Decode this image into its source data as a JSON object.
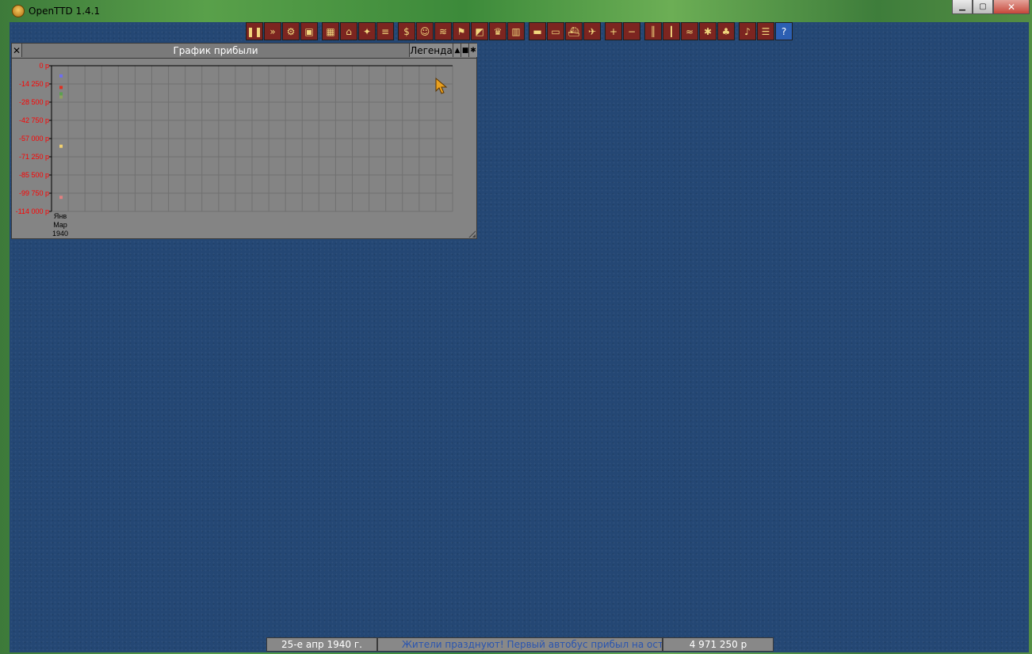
{
  "window": {
    "title": "OpenTTD 1.4.1",
    "controls": {
      "minimize": "▁",
      "maximize": "▢",
      "close": "✕"
    }
  },
  "toolbar": {
    "buttons": [
      {
        "name": "pause-button",
        "icon": "pause-icon",
        "glyph": "❚❚"
      },
      {
        "name": "fast-forward-button",
        "icon": "fast-forward-icon",
        "glyph": "»"
      },
      {
        "name": "settings-button",
        "icon": "gear-icon",
        "glyph": "⚙"
      },
      {
        "name": "save-button",
        "icon": "disk-icon",
        "glyph": "▣"
      },
      {
        "name": "map-button",
        "icon": "map-icon",
        "glyph": "▦"
      },
      {
        "name": "town-list-button",
        "icon": "town-icon",
        "glyph": "⌂"
      },
      {
        "name": "subsidies-button",
        "icon": "subsidies-icon",
        "glyph": "✦"
      },
      {
        "name": "station-list-button",
        "icon": "station-icon",
        "glyph": "≡"
      },
      {
        "name": "finances-button",
        "icon": "coins-icon",
        "glyph": "$"
      },
      {
        "name": "company-button",
        "icon": "face-icon",
        "glyph": "☺"
      },
      {
        "name": "story-button",
        "icon": "book-icon",
        "glyph": "≋"
      },
      {
        "name": "goals-button",
        "icon": "flag-icon",
        "glyph": "⚑"
      },
      {
        "name": "graphs-button",
        "icon": "graph-icon",
        "glyph": "◩"
      },
      {
        "name": "league-button",
        "icon": "trophy-icon",
        "glyph": "♛"
      },
      {
        "name": "industries-button",
        "icon": "factory-icon",
        "glyph": "▥"
      },
      {
        "name": "trains-button",
        "icon": "train-icon",
        "glyph": "▬"
      },
      {
        "name": "road-vehicles-button",
        "icon": "bus-icon",
        "glyph": "▭"
      },
      {
        "name": "ships-button",
        "icon": "ship-icon",
        "glyph": "⛴"
      },
      {
        "name": "aircraft-button",
        "icon": "plane-icon",
        "glyph": "✈"
      },
      {
        "name": "zoom-in-button",
        "icon": "zoom-in-icon",
        "glyph": "+"
      },
      {
        "name": "zoom-out-button",
        "icon": "zoom-out-icon",
        "glyph": "−"
      },
      {
        "name": "build-rail-button",
        "icon": "rail-icon",
        "glyph": "║"
      },
      {
        "name": "build-road-button",
        "icon": "road-icon",
        "glyph": "┃"
      },
      {
        "name": "build-water-button",
        "icon": "water-icon",
        "glyph": "≈"
      },
      {
        "name": "build-air-button",
        "icon": "airport-icon",
        "glyph": "✱"
      },
      {
        "name": "landscaping-button",
        "icon": "tree-icon",
        "glyph": "♣"
      },
      {
        "name": "sound-button",
        "icon": "speaker-icon",
        "glyph": "♪"
      },
      {
        "name": "messages-button",
        "icon": "list-icon",
        "glyph": "☰"
      },
      {
        "name": "help-button",
        "icon": "help-icon",
        "glyph": "?"
      }
    ]
  },
  "graph_window": {
    "title": "График прибыли",
    "legend_label": "Легенда",
    "close_glyph": "✕",
    "collapse_glyph": "▲",
    "shade_glyph": "■",
    "sticky_glyph": "✱"
  },
  "chart_data": {
    "type": "line",
    "title": "",
    "xlabel": "",
    "ylabel": "",
    "yticks": [
      "0 р",
      "-14 250 р",
      "-28 500 р",
      "-42 750 р",
      "-57 000 р",
      "-71 250 р",
      "-85 500 р",
      "-99 750 р",
      "-114 000 р"
    ],
    "ylim": [
      -114000,
      0
    ],
    "x_label_lines": [
      "Янв",
      "Мар",
      "1940"
    ],
    "grid": true,
    "colors": {
      "grid": "#707070",
      "axis": "#000000",
      "tick_text": "#ff0000",
      "background": "#848484"
    },
    "series": [
      {
        "color": "#6e6ef0",
        "values": [
          -8000
        ]
      },
      {
        "color": "#e03020",
        "values": [
          -17000
        ]
      },
      {
        "color": "#5aa050",
        "values": [
          -22000
        ]
      },
      {
        "color": "#90a060",
        "values": [
          -24500
        ]
      },
      {
        "color": "#f0d070",
        "values": [
          -63000
        ]
      },
      {
        "color": "#e08080",
        "values": [
          -103000
        ]
      }
    ]
  },
  "statusbar": {
    "date": "25-е апр 1940 г.",
    "news": "Жители празднуют!    Первый автобус прибыл на остан",
    "money": "4 971 250 р"
  }
}
